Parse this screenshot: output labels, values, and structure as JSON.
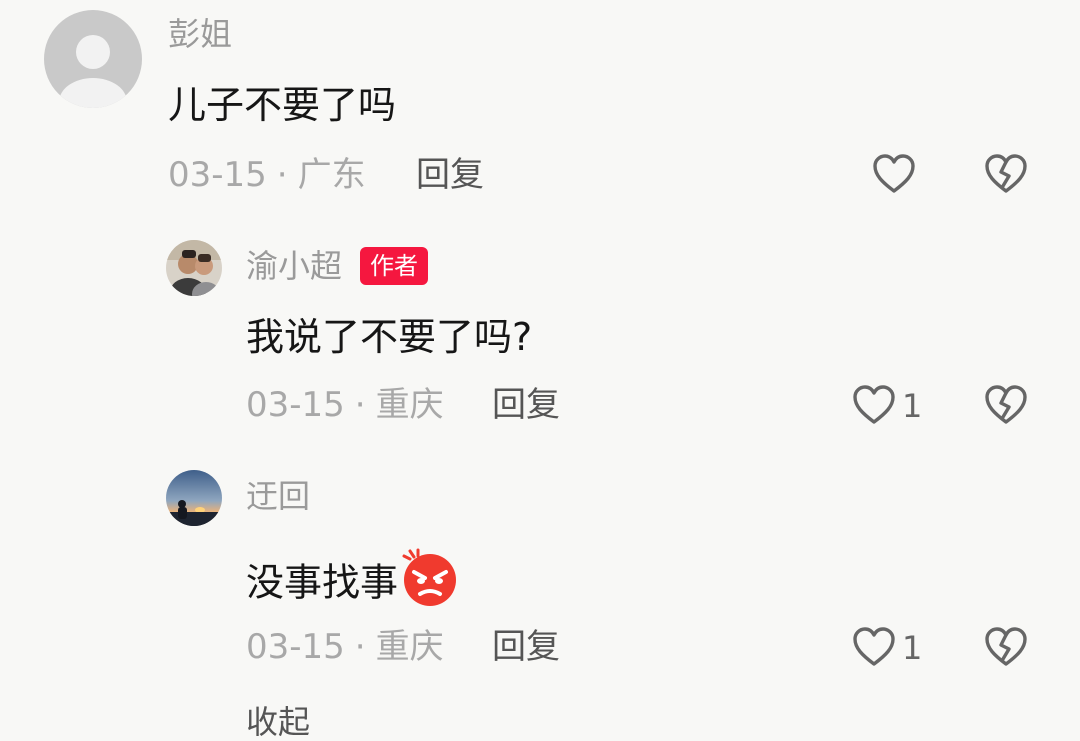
{
  "comments": [
    {
      "username": "彭姐",
      "text": "儿子不要了吗",
      "date": "03-15",
      "location": "广东",
      "reply_label": "回复",
      "like_count": "",
      "avatar": "default-avatar-icon"
    },
    {
      "username": "渝小超",
      "author_tag": "作者",
      "text": "我说了不要了吗?",
      "date": "03-15",
      "location": "重庆",
      "reply_label": "回复",
      "like_count": "1",
      "avatar": "user-photo-avatar"
    },
    {
      "username": "迂回",
      "text": "没事找事",
      "text_emoji": "angry-face-emoji",
      "date": "03-15",
      "location": "重庆",
      "reply_label": "回复",
      "like_count": "1",
      "avatar": "sunset-photo-avatar"
    }
  ],
  "collapse_label": "收起",
  "colors": {
    "author_tag_bg": "#f5173f",
    "meta_text": "#a8a8a8",
    "username_text": "#9a9a9a"
  }
}
